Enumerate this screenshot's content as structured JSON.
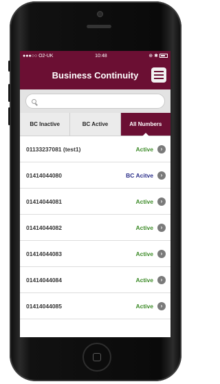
{
  "status_bar": {
    "carrier": "●●●○○ O2-UK",
    "wifi_icon": "wifi-icon",
    "time": "10:48",
    "right_icons": "⊕ ✱"
  },
  "header": {
    "title": "Business Continuity"
  },
  "search": {
    "placeholder": "",
    "value": ""
  },
  "tabs": [
    {
      "label": "BC Inactive",
      "active": false
    },
    {
      "label": "BC Active",
      "active": false
    },
    {
      "label": "All Numbers",
      "active": true
    }
  ],
  "rows": [
    {
      "number": "01133237081 (test1)",
      "status": "Active",
      "type": "active"
    },
    {
      "number": "01414044080",
      "status": "BC Acitve",
      "type": "bc"
    },
    {
      "number": "01414044081",
      "status": "Active",
      "type": "active"
    },
    {
      "number": "01414044082",
      "status": "Active",
      "type": "active"
    },
    {
      "number": "01414044083",
      "status": "Active",
      "type": "active"
    },
    {
      "number": "01414044084",
      "status": "Active",
      "type": "active"
    },
    {
      "number": "01414044085",
      "status": "Active",
      "type": "active"
    }
  ],
  "colors": {
    "brand": "#6b0f33",
    "active_status": "#3b8a26",
    "bc_status": "#2b2f8a"
  }
}
